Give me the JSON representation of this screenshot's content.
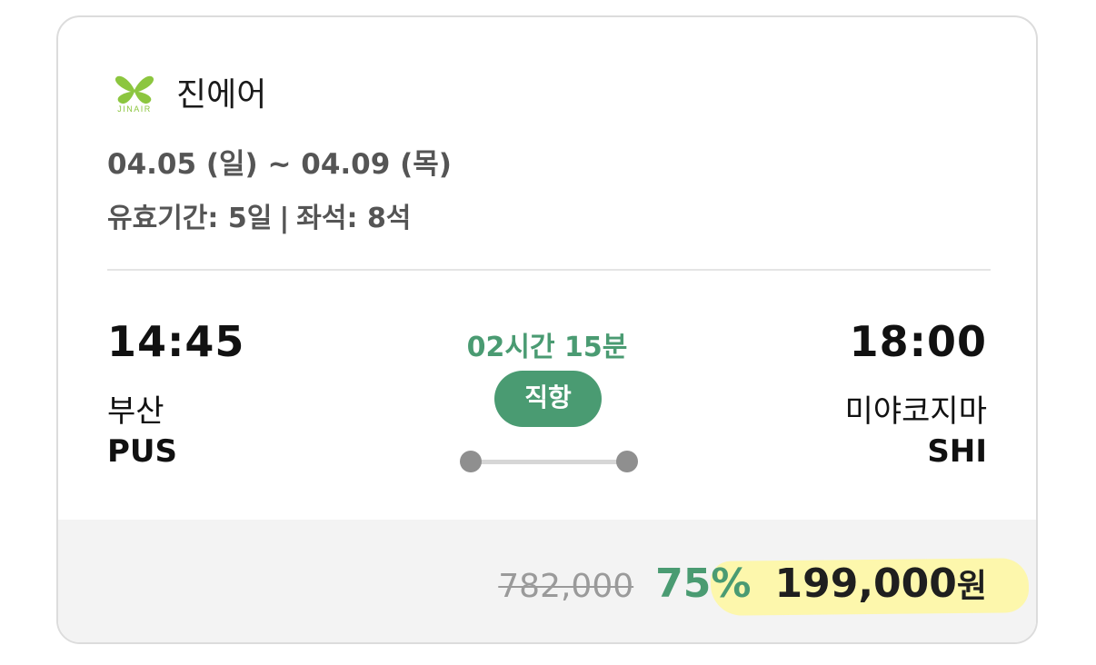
{
  "airline": {
    "name": "진에어",
    "logo_text": "JINAIR",
    "logo_icon": "butterfly-logo",
    "brand_color": "#8cc63f"
  },
  "trip": {
    "dates": "04.05 (일) ~ 04.09 (목)",
    "validity_label": "유효기간: 5일",
    "separator": "|",
    "seats_label": "좌석: 8석"
  },
  "flight": {
    "departure": {
      "time": "14:45",
      "city": "부산",
      "code": "PUS"
    },
    "arrival": {
      "time": "18:00",
      "city": "미야코지마",
      "code": "SHI"
    },
    "duration": "02시간 15분",
    "type": "직항"
  },
  "price": {
    "original": "782,000",
    "discount": "75%",
    "final": "199,000",
    "currency": "원"
  },
  "colors": {
    "accent": "#4a9b72",
    "highlight": "#fdf7a8",
    "price_area_bg": "#f3f3f3"
  }
}
